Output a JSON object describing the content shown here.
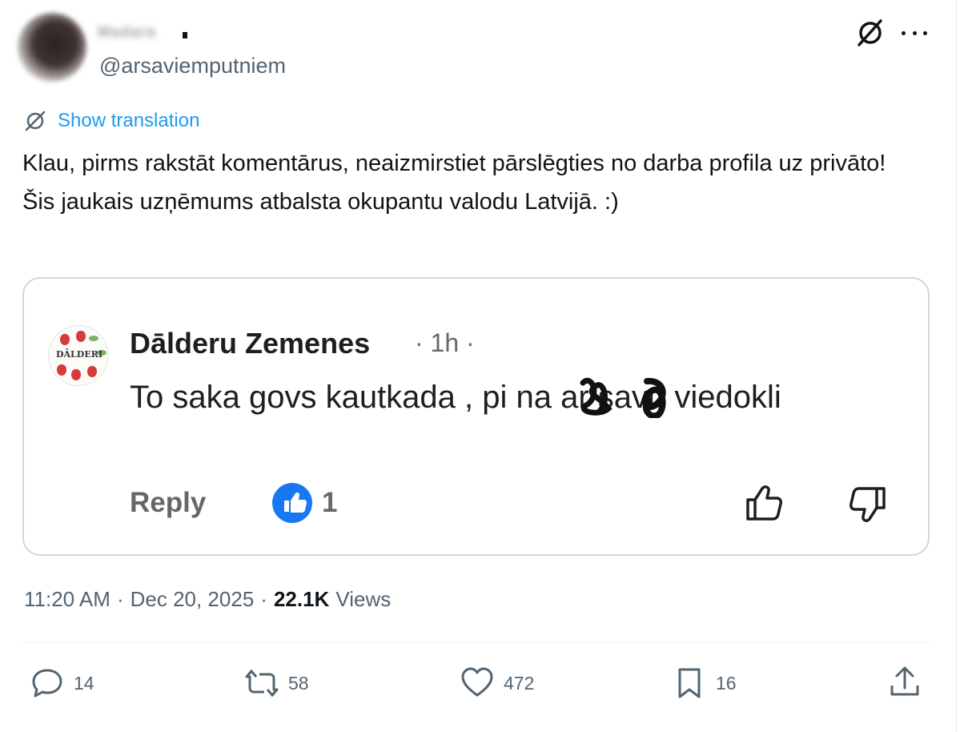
{
  "author": {
    "display_name": "Madara",
    "handle": "@arsaviemputniem"
  },
  "header_icons": [
    "grok-icon",
    "more-icon"
  ],
  "translation": {
    "icon": "translate-icon",
    "label": "Show translation"
  },
  "tweet": {
    "text": "Klau, pirms rakstāt komentārus, neaizmirstiet pārslēgties no darba profila uz privāto! Šis jaukais uzņēmums atbalsta okupantu valodu Latvijā. :)"
  },
  "embedded_comment": {
    "avatar_label": "DĀLDERI",
    "author": "Dālderu Zemenes",
    "meta": "· 1h ·",
    "text": "To saka govs kautkada , pi     na     ar savu viedokli",
    "reply_label": "Reply",
    "like_count": "1",
    "icons": [
      "like-badge-icon",
      "thumbs-up-icon",
      "thumbs-down-icon"
    ]
  },
  "timestamp": {
    "time": "11:20 AM",
    "sep1": "·",
    "date": "Dec 20, 2025",
    "sep2": "·",
    "views_count": "22.1K",
    "views_label": "Views"
  },
  "actions": {
    "replies": "14",
    "reposts": "58",
    "likes": "472",
    "bookmarks": "16"
  },
  "colors": {
    "link_blue": "#1d9bf0",
    "text_primary": "#0f1419",
    "text_secondary": "#536471",
    "facebook_blue": "#1877f2",
    "card_border": "#cfd9de"
  }
}
